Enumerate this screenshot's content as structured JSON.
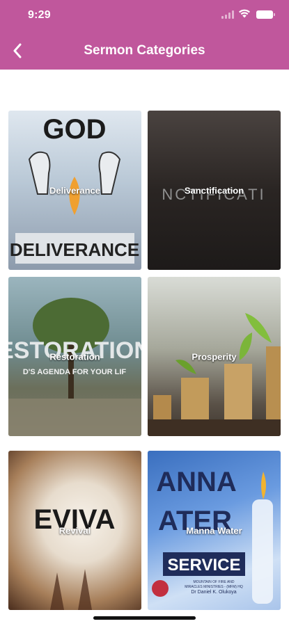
{
  "status_bar": {
    "time": "9:29"
  },
  "header": {
    "title": "Sermon Categories",
    "background": "#c0579c",
    "back_icon": "chevron-left-icon"
  },
  "categories": [
    {
      "label": "Deliverance",
      "art": {
        "top": "GOD",
        "bottom": "DELIVERANCE"
      }
    },
    {
      "label": "Sanctification",
      "art": {
        "text": "NCTIFICATI"
      }
    },
    {
      "label": "Restoration",
      "art": {
        "text": "ESTORATION",
        "sub": "D'S AGENDA FOR YOUR LIF"
      }
    },
    {
      "label": "Prosperity",
      "art": {}
    },
    {
      "label": "Revival",
      "art": {
        "text": "EVIVA"
      }
    },
    {
      "label": "Manna Water",
      "art": {
        "line1": "ANNA",
        "line2": "ATER",
        "line3": "SERVICE",
        "line4": "MOUNTAIN OF FIRE AND",
        "line5": "MIRACLES MINISTRIES - (MFM) HQ",
        "line6": "Dr Daniel K. Olukoya"
      }
    }
  ]
}
